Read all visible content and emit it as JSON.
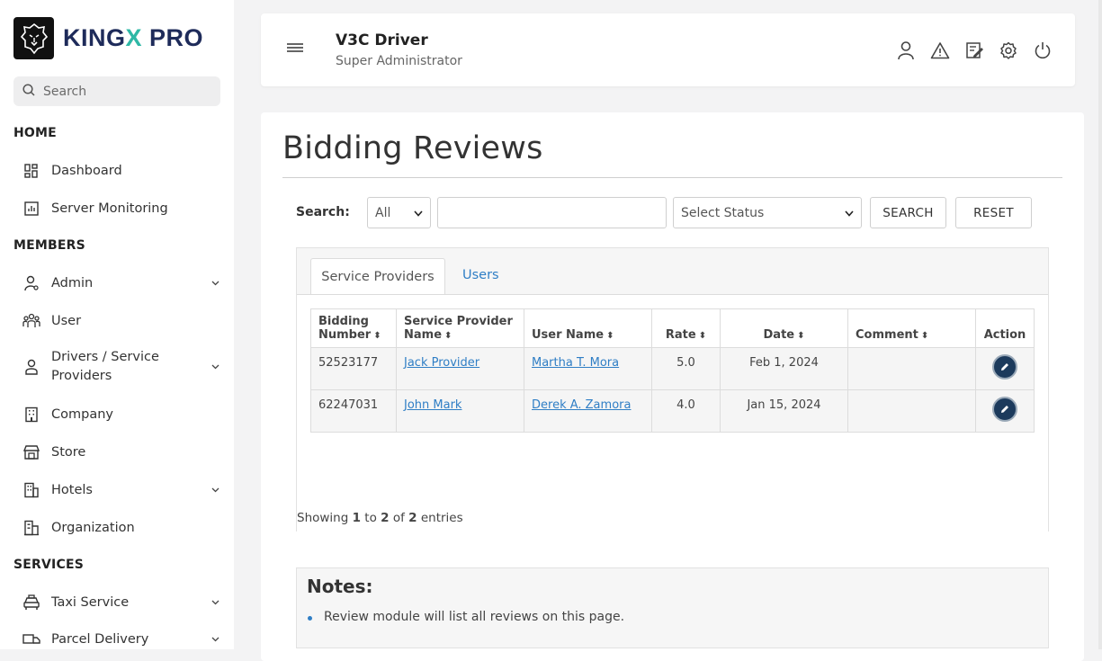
{
  "brand": {
    "name_part1": "KING",
    "name_x": "X",
    "name_part2": " PRO"
  },
  "sidebar": {
    "search_placeholder": "Search",
    "sections": {
      "home": "HOME",
      "members": "MEMBERS",
      "services": "SERVICES"
    },
    "items": {
      "dashboard": "Dashboard",
      "server_monitoring": "Server Monitoring",
      "admin": "Admin",
      "user": "User",
      "drivers": "Drivers / Service Providers",
      "company": "Company",
      "store": "Store",
      "hotels": "Hotels",
      "organization": "Organization",
      "taxi_service": "Taxi Service",
      "parcel_delivery": "Parcel Delivery"
    }
  },
  "header": {
    "title": "V3C Driver",
    "subtitle": "Super Administrator"
  },
  "page": {
    "title": "Bidding Reviews",
    "search_label": "Search:",
    "filter_selected": "All",
    "status_selected": "Select Status",
    "search_button": "SEARCH",
    "reset_button": "RESET"
  },
  "tabs": {
    "service_providers": "Service Providers",
    "users": "Users"
  },
  "table": {
    "headers": {
      "bidding_number_1": "Bidding",
      "bidding_number_2": "Number",
      "provider_1": "Service Provider",
      "provider_2": "Name",
      "user_name": "User Name",
      "rate": "Rate",
      "date": "Date",
      "comment": "Comment",
      "action": "Action"
    },
    "rows": [
      {
        "bidding_number": "52523177",
        "provider": "Jack Provider",
        "user": "Martha T. Mora",
        "rate": "5.0",
        "date": "Feb 1, 2024",
        "comment": ""
      },
      {
        "bidding_number": "62247031",
        "provider": "John Mark",
        "user": "Derek A. Zamora",
        "rate": "4.0",
        "date": "Jan 15, 2024",
        "comment": ""
      }
    ]
  },
  "pagination": {
    "showing": "Showing ",
    "from": "1",
    "to_word": " to ",
    "to": "2",
    "of_word": " of ",
    "total": "2",
    "entries": " entries"
  },
  "notes": {
    "title": "Notes:",
    "items": [
      "Review module will list all reviews on this page."
    ]
  },
  "colors": {
    "brand_navy": "#1e2b5a",
    "brand_teal": "#2fb8a6",
    "link": "#2f7ec5",
    "edit_button": "#1c3a5c"
  }
}
